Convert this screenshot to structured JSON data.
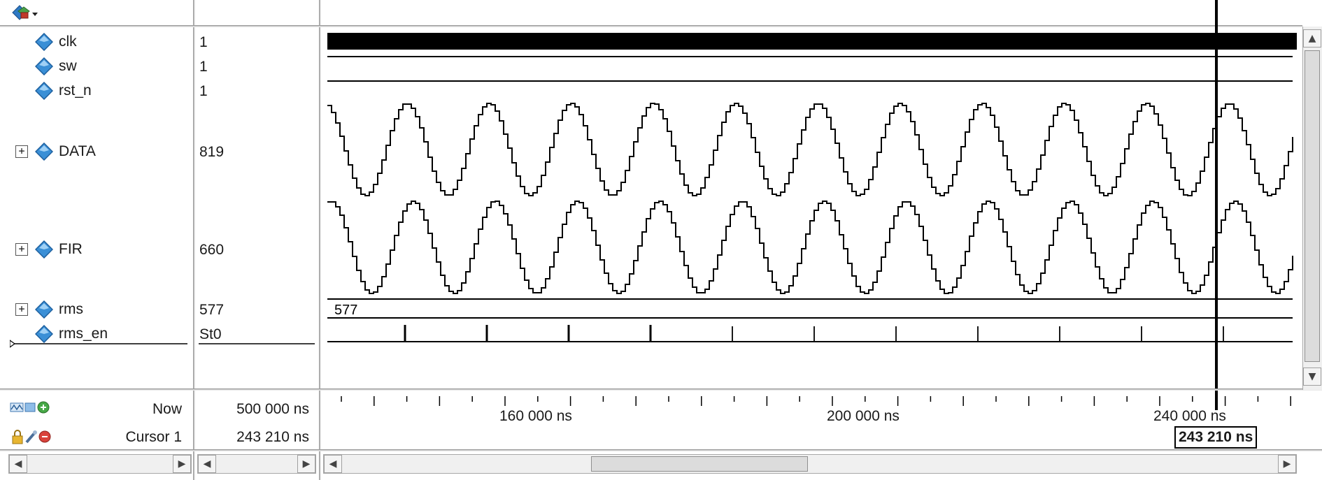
{
  "signals": [
    {
      "name": "clk",
      "value": "1",
      "expandable": false
    },
    {
      "name": "sw",
      "value": "1",
      "expandable": false
    },
    {
      "name": "rst_n",
      "value": "1",
      "expandable": false
    },
    {
      "name": "DATA",
      "value": "819",
      "expandable": true
    },
    {
      "name": "FIR",
      "value": "660",
      "expandable": true
    },
    {
      "name": "rms",
      "value": "577",
      "expandable": true
    },
    {
      "name": "rms_en",
      "value": "St0",
      "expandable": false
    }
  ],
  "wave": {
    "rms_bus_label": "577"
  },
  "footer": {
    "now_label": "Now",
    "now_value": "500 000 ns",
    "cursor_label": "Cursor 1",
    "cursor_value": "243 210 ns"
  },
  "timeline": {
    "tick_labels": [
      "160 000 ns",
      "200 000 ns",
      "240 000 ns"
    ],
    "cursor_readout": "243 210 ns"
  },
  "icons": {
    "toolbar": "wave-layout-icon",
    "signal": "diamond-signal-icon",
    "expand": "plus-expand-icon",
    "now_row": [
      "zoom-wave-icon",
      "add-cursor-icon"
    ],
    "cursor_row": [
      "lock-icon",
      "edit-icon",
      "delete-cursor-icon"
    ]
  },
  "colors": {
    "diamond_fill": "#3a8fd6",
    "diamond_dark": "#1d5f9e",
    "wave": "#000000",
    "divider": "#c9c9c9"
  }
}
